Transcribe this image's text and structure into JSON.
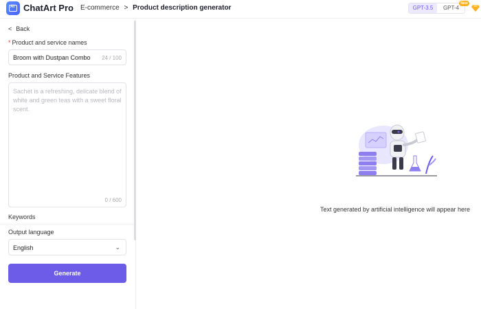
{
  "header": {
    "logo_glyph": "AI",
    "app_name": "ChatArt Pro",
    "breadcrumb": {
      "parent": "E-commerce",
      "separator": ">",
      "current": "Product description generator"
    },
    "models": {
      "gpt35": "GPT-3.5",
      "gpt4": "GPT-4",
      "new_badge": "New"
    },
    "accent_color": "#6c5ce7"
  },
  "sidebar": {
    "back_label": "Back",
    "product_name": {
      "required_mark": "*",
      "label": "Product and service names",
      "value": "Broom with Dustpan Combo",
      "counter": "24 / 100"
    },
    "features": {
      "label": "Product and Service Features",
      "placeholder": "Sachet is a refreshing, delicate blend of white and green teas with a sweet floral scent.",
      "counter": "0 / 600"
    },
    "keywords_label": "Keywords",
    "output_language": {
      "label": "Output language",
      "value": "English"
    },
    "generate_label": "Generate"
  },
  "main": {
    "empty_state_text": "Text generated by artificial intelligence will appear here"
  },
  "icons": [
    "logo-icon",
    "chevron-left-icon",
    "chevron-down-icon",
    "gem-icon",
    "robot-illustration"
  ]
}
